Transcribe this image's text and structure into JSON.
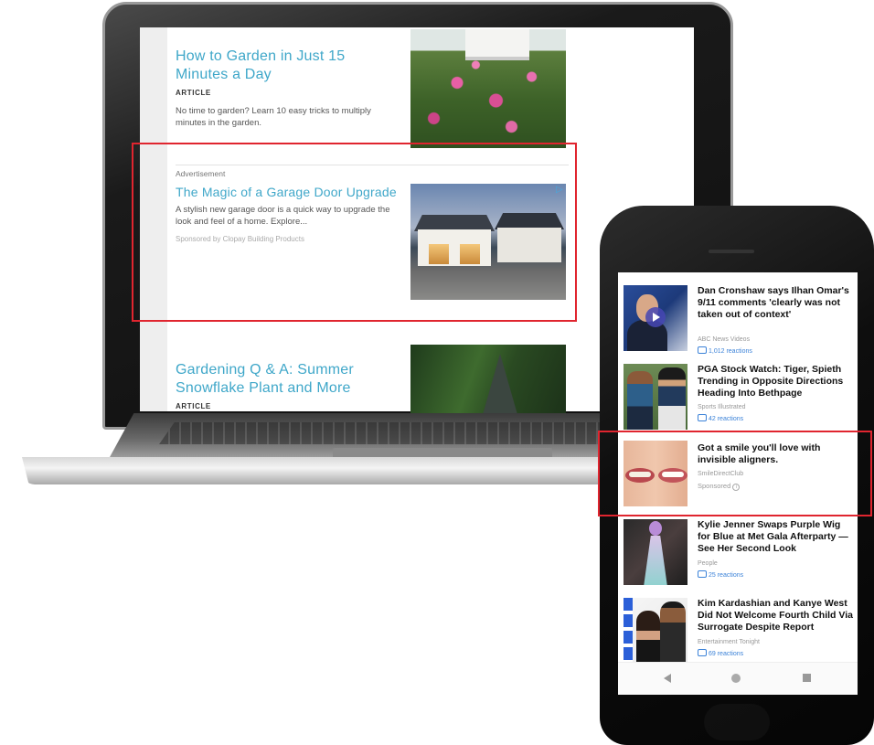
{
  "laptop": {
    "article1": {
      "title": "How to Garden in Just 15 Minutes a Day",
      "kicker": "ARTICLE",
      "description": "No time to garden? Learn 10 easy tricks to multiply minutes in the garden."
    },
    "ad": {
      "label": "Advertisement",
      "title": "The Magic of a Garage Door Upgrade",
      "description": "A stylish new garage door is a quick way to upgrade the look and feel of a home. Explore...",
      "sponsor": "Sponsored by Clopay Building Products",
      "adchoices_glyph": "▷"
    },
    "article2": {
      "title": "Gardening Q & A: Summer Snowflake Plant and More",
      "kicker": "ARTICLE"
    }
  },
  "phone": {
    "feed": [
      {
        "title": "Dan Cronshaw says Ilhan Omar's 9/11 comments 'clearly was not taken out of context'",
        "source": "ABC News Videos",
        "reactions": "1,012 reactions"
      },
      {
        "title": "PGA Stock Watch: Tiger, Spieth Trending in Opposite Directions Heading Into Bethpage",
        "source": "Sports Illustrated",
        "reactions": "42 reactions"
      },
      {
        "title": "Got a smile you'll love with invisible aligners.",
        "source": "SmileDirectClub",
        "sponsored": "Sponsored",
        "info_glyph": "i"
      },
      {
        "title": "Kylie Jenner Swaps Purple Wig for Blue at Met Gala Afterparty — See Her Second Look",
        "source": "People",
        "reactions": "25 reactions"
      },
      {
        "title": "Kim Kardashian and Kanye West Did Not Welcome Fourth Child Via Surrogate Despite Report",
        "source": "Entertainment Tonight",
        "reactions": "69 reactions"
      }
    ]
  },
  "colors": {
    "highlight": "#e0252f",
    "link": "#3fa7c9",
    "reaction": "#3b82d8"
  }
}
